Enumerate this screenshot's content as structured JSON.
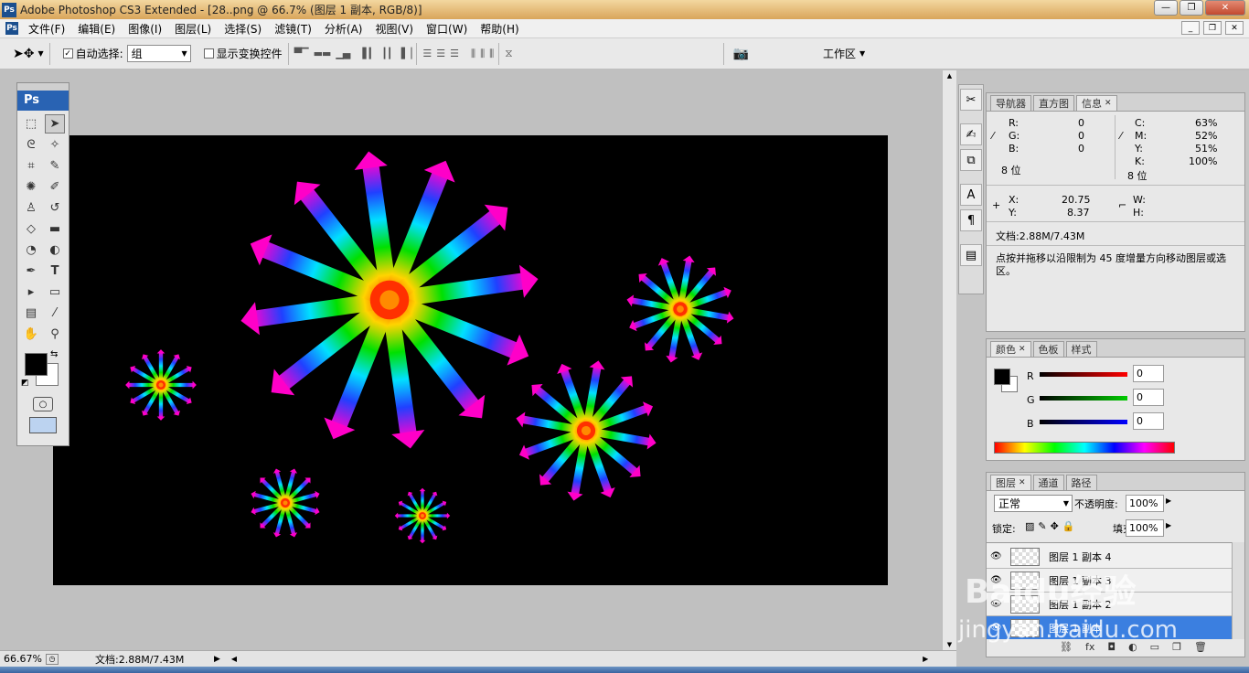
{
  "window": {
    "title": "Adobe Photoshop CS3 Extended - [28..png @ 66.7% (图层 1 副本, RGB/8)]",
    "min": "—",
    "max": "❐",
    "close": "✕"
  },
  "menu": [
    "文件(F)",
    "编辑(E)",
    "图像(I)",
    "图层(L)",
    "选择(S)",
    "滤镜(T)",
    "分析(A)",
    "视图(V)",
    "窗口(W)",
    "帮助(H)"
  ],
  "options": {
    "auto_select_label": "自动选择:",
    "auto_select_value": "组",
    "show_transform_label": "显示变换控件",
    "workspace_label": "工作区"
  },
  "toolbox": {
    "logo": "Ps"
  },
  "status": {
    "zoom": "66.67%",
    "doc": "文档:2.88M/7.43M"
  },
  "info_panel": {
    "tabs": [
      "导航器",
      "直方图",
      "信息"
    ],
    "r_label": "R:",
    "r": "0",
    "g_label": "G:",
    "g": "0",
    "b_label": "B:",
    "b": "0",
    "c_label": "C:",
    "c": "63%",
    "m_label": "M:",
    "m": "52%",
    "y_label": "Y:",
    "y": "51%",
    "k_label": "K:",
    "k": "100%",
    "bits_left": "8 位",
    "bits_right": "8 位",
    "x_label": "X:",
    "x": "20.75",
    "y2_label": "Y:",
    "y2": "8.37",
    "w_label": "W:",
    "h_label": "H:",
    "doc": "文档:2.88M/7.43M",
    "hint": "点按并拖移以沿限制为 45 度增量方向移动图层或选区。"
  },
  "color_panel": {
    "tabs": [
      "颜色",
      "色板",
      "样式"
    ],
    "r_label": "R",
    "r": "0",
    "g_label": "G",
    "g": "0",
    "b_label": "B",
    "b": "0"
  },
  "layers_panel": {
    "tabs": [
      "图层",
      "通道",
      "路径"
    ],
    "blend": "正常",
    "opacity_label": "不透明度:",
    "opacity": "100%",
    "lock_label": "锁定:",
    "fill_label": "填充:",
    "fill": "100%",
    "layers": [
      "图层 1 副本 4",
      "图层 1 副本 3",
      "图层 1 副本 2",
      "图层 1 副本"
    ]
  },
  "watermark": {
    "brand": "Baidu经验",
    "url": "jingyan.baidu.com"
  }
}
